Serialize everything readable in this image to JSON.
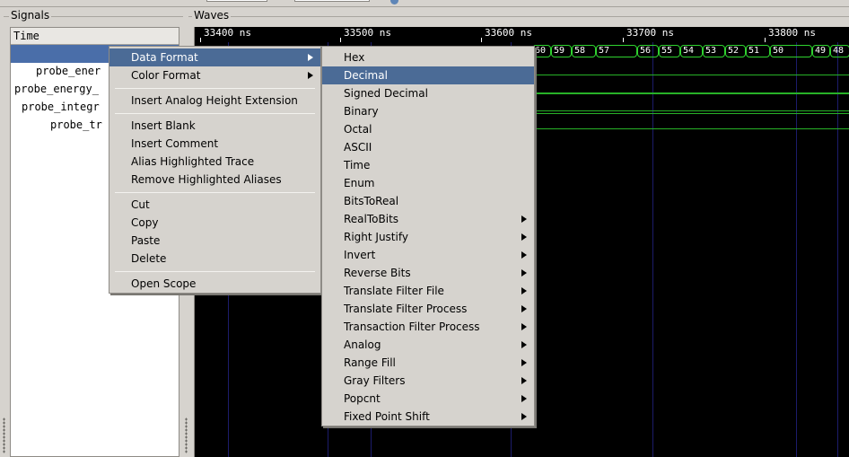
{
  "toolbar": {
    "partial": true
  },
  "signals": {
    "title": "Signals",
    "header": "Time",
    "rows": [
      {
        "label": "",
        "selected": true
      },
      {
        "label": "probe_ener"
      },
      {
        "label": "probe_energy_"
      },
      {
        "label": "probe_integr"
      },
      {
        "label": "probe_tr"
      }
    ]
  },
  "waves": {
    "title": "Waves",
    "ruler": [
      "33400 ns",
      "33500 ns",
      "33600 ns",
      "33700 ns",
      "33800 ns"
    ],
    "bus_values": [
      "60",
      "59",
      "58",
      "57",
      "56",
      "55",
      "54",
      "53",
      "52",
      "51",
      "50",
      "49",
      "48"
    ]
  },
  "context_menu": {
    "items": [
      {
        "label": "Data Format",
        "submenu": true,
        "highlight": true
      },
      {
        "label": "Color Format",
        "submenu": true
      },
      {
        "separator": true
      },
      {
        "label": "Insert Analog Height Extension"
      },
      {
        "separator": true
      },
      {
        "label": "Insert Blank"
      },
      {
        "label": "Insert Comment"
      },
      {
        "label": "Alias Highlighted Trace"
      },
      {
        "label": "Remove Highlighted Aliases"
      },
      {
        "separator": true
      },
      {
        "label": "Cut"
      },
      {
        "label": "Copy"
      },
      {
        "label": "Paste"
      },
      {
        "label": "Delete"
      },
      {
        "separator": true
      },
      {
        "label": "Open Scope"
      }
    ]
  },
  "data_format_menu": {
    "items": [
      {
        "label": "Hex"
      },
      {
        "label": "Decimal",
        "highlight": true
      },
      {
        "label": "Signed Decimal"
      },
      {
        "label": "Binary"
      },
      {
        "label": "Octal"
      },
      {
        "label": "ASCII"
      },
      {
        "label": "Time"
      },
      {
        "label": "Enum"
      },
      {
        "label": "BitsToReal"
      },
      {
        "label": "RealToBits",
        "submenu": true
      },
      {
        "label": "Right Justify",
        "submenu": true
      },
      {
        "label": "Invert",
        "submenu": true
      },
      {
        "label": "Reverse Bits",
        "submenu": true
      },
      {
        "label": "Translate Filter File",
        "submenu": true
      },
      {
        "label": "Translate Filter Process",
        "submenu": true
      },
      {
        "label": "Transaction Filter Process",
        "submenu": true
      },
      {
        "label": "Analog",
        "submenu": true
      },
      {
        "label": "Range Fill",
        "submenu": true
      },
      {
        "label": "Gray Filters",
        "submenu": true
      },
      {
        "label": "Popcnt",
        "submenu": true
      },
      {
        "label": "Fixed Point Shift",
        "submenu": true
      }
    ]
  },
  "colors": {
    "highlight": "#4b6b96",
    "selection": "#4a6ea9",
    "trace": "#2fd22f",
    "grid": "#1c1c6b"
  }
}
